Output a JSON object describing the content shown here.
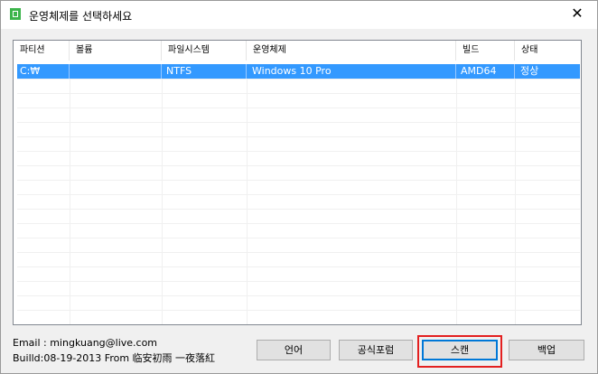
{
  "window": {
    "title": "운영체제를 선택하세요",
    "close_glyph": "✕"
  },
  "table": {
    "columns": [
      "파티션",
      "볼륨",
      "파일시스템",
      "운영체제",
      "빌드",
      "상태"
    ],
    "rows": [
      {
        "partition": "C:₩",
        "volume": "",
        "filesystem": "NTFS",
        "os": "Windows 10 Pro",
        "build": "AMD64",
        "status": "정상",
        "selected": true
      }
    ]
  },
  "info": {
    "email": "Email : mingkuang@live.com",
    "build": "Builld:08-19-2013 From 临安初雨 一夜落紅"
  },
  "buttons": {
    "language": "언어",
    "forum": "공식포럼",
    "scan": "스캔",
    "backup": "백업"
  },
  "colors": {
    "selection": "#3399ff",
    "highlight_box": "#e32020",
    "app_icon": "#3cb44b"
  },
  "icons": {
    "app": "green-square-icon",
    "close": "close-icon"
  }
}
